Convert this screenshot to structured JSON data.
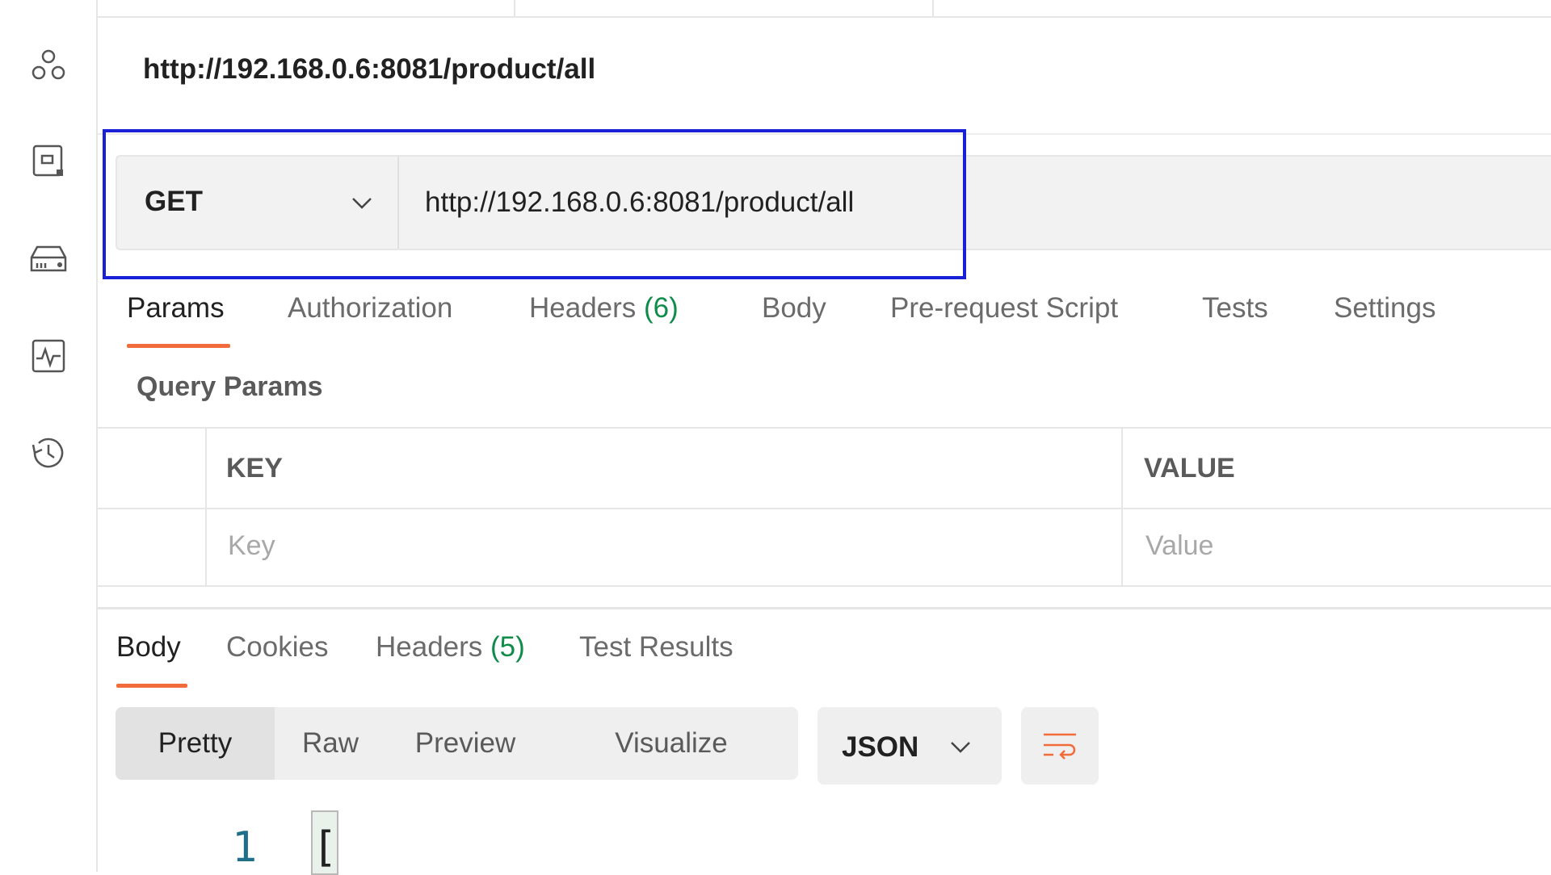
{
  "sidebar": {
    "items": [
      {
        "icon": "collections-icon"
      },
      {
        "icon": "environments-icon"
      },
      {
        "icon": "mock-servers-icon"
      },
      {
        "icon": "monitors-icon"
      },
      {
        "icon": "history-icon"
      }
    ]
  },
  "request": {
    "title": "http://192.168.0.6:8081/product/all",
    "method": "GET",
    "url": "http://192.168.0.6:8081/product/all"
  },
  "request_tabs": [
    {
      "label": "Params",
      "count": ""
    },
    {
      "label": "Authorization",
      "count": ""
    },
    {
      "label": "Headers",
      "count": "(6)"
    },
    {
      "label": "Body",
      "count": ""
    },
    {
      "label": "Pre-request Script",
      "count": ""
    },
    {
      "label": "Tests",
      "count": ""
    },
    {
      "label": "Settings",
      "count": ""
    }
  ],
  "query_params": {
    "label": "Query Params",
    "columns": [
      "KEY",
      "VALUE"
    ],
    "placeholders": {
      "key": "Key",
      "value": "Value"
    }
  },
  "response_tabs": [
    {
      "label": "Body",
      "count": ""
    },
    {
      "label": "Cookies",
      "count": ""
    },
    {
      "label": "Headers",
      "count": "(5)"
    },
    {
      "label": "Test Results",
      "count": ""
    }
  ],
  "response_formats": [
    "Pretty",
    "Raw",
    "Preview",
    "Visualize"
  ],
  "response_language": "JSON",
  "response_body": {
    "line_number": "1",
    "first_token": "["
  },
  "colors": {
    "accent": "#f26b3a",
    "count_green": "#0f8c4a",
    "highlight": "#1a20d6"
  }
}
